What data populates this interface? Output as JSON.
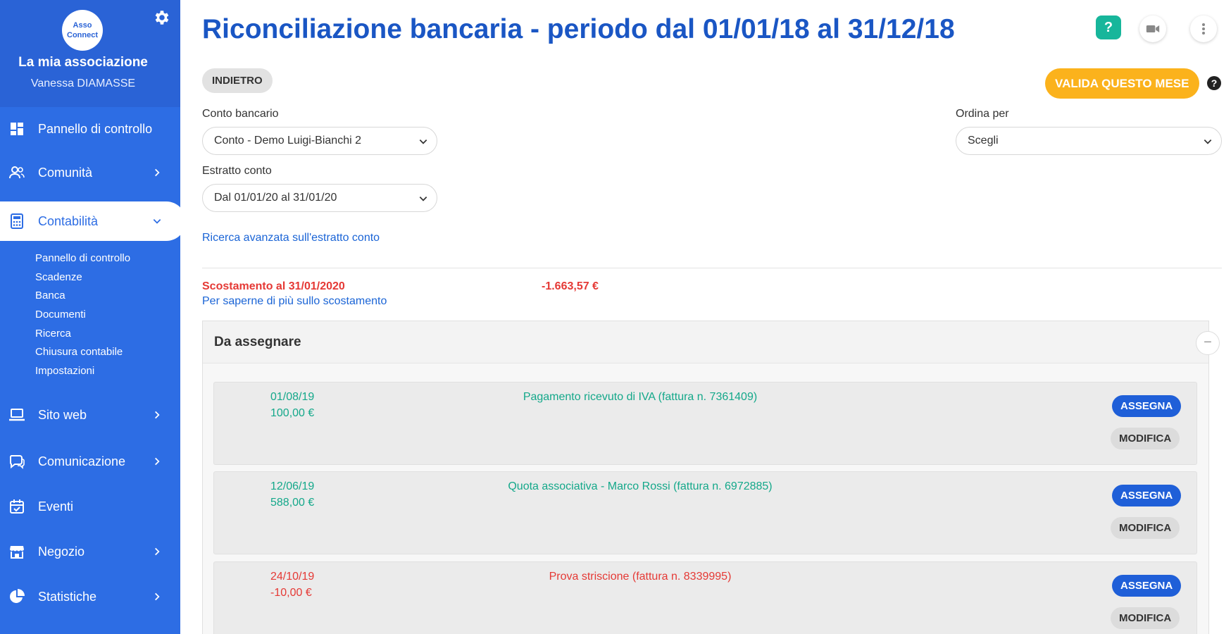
{
  "sidebar": {
    "logo_line1": "Asso",
    "logo_line2": "Connect",
    "org_name": "La mia associazione",
    "user_name": "Vanessa DIAMASSE",
    "nav": {
      "dashboard": "Pannello di controllo",
      "community": "Comunità",
      "accounting": "Contabilità",
      "website": "Sito web",
      "communication": "Comunicazione",
      "events": "Eventi",
      "shop": "Negozio",
      "stats": "Statistiche"
    },
    "subnav": [
      "Pannello di controllo",
      "Scadenze",
      "Banca",
      "Documenti",
      "Ricerca",
      "Chiusura contabile",
      "Impostazioni"
    ]
  },
  "header": {
    "title": "Riconciliazione bancaria - periodo dal 01/01/18 al 31/12/18",
    "help_label": "?"
  },
  "toolbar": {
    "back_label": "INDIETRO",
    "validate_label": "VALIDA QUESTO MESE",
    "help_label": "?"
  },
  "filters": {
    "account_label": "Conto bancario",
    "account_value": "Conto - Demo Luigi-Bianchi 2",
    "statement_label": "Estratto conto",
    "statement_value": "Dal 01/01/20 al 31/01/20",
    "sort_label": "Ordina per",
    "sort_value": "Scegli",
    "advanced_search": "Ricerca avanzata sull'estratto conto"
  },
  "gap": {
    "label": "Scostamento al 31/01/2020",
    "value": "-1.663,57 €",
    "more_link": "Per saperne di più sullo scostamento"
  },
  "panel": {
    "title": "Da assegnare",
    "collapse_label": "−",
    "assign_label": "ASSEGNA",
    "edit_label": "MODIFICA",
    "rows": [
      {
        "date": "01/08/19",
        "amount": "100,00 €",
        "description": "Pagamento ricevuto di IVA (fattura n. 7361409)"
      },
      {
        "date": "12/06/19",
        "amount": "588,00 €",
        "description": "Quota associativa - Marco Rossi (fattura n. 6972885)"
      },
      {
        "date": "24/10/19",
        "amount": "-10,00 €",
        "description": "Prova striscione (fattura n. 8339995)"
      }
    ]
  },
  "colors": {
    "sidebar": "#2d6de4",
    "primary": "#1a56c4",
    "accent": "#fbb21c",
    "positive": "#14a88a",
    "negative": "#e53935"
  }
}
